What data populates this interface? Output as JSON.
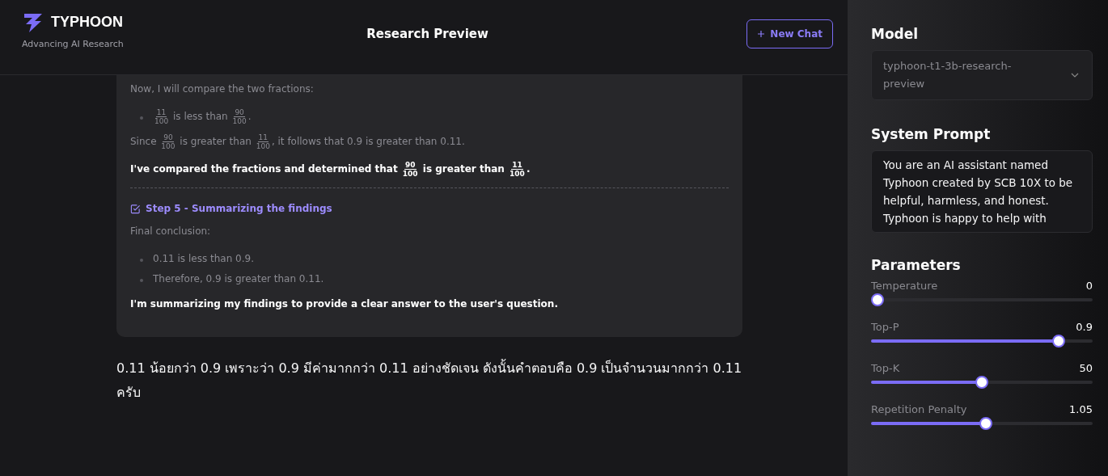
{
  "header": {
    "logo_title": "TYPHOON",
    "logo_subtitle": "Advancing AI Research",
    "title": "Research Preview",
    "new_chat_button": "New Chat"
  },
  "card": {
    "blocks": [
      {
        "kind": "paragraph",
        "strong": false,
        "segments": [
          {
            "kind": "text",
            "text": "Now, I will compare the two fractions:"
          }
        ]
      },
      {
        "kind": "bullets",
        "items": [
          [
            {
              "kind": "frac",
              "num": "11",
              "den": "100"
            },
            {
              "kind": "text",
              "text": " is less than "
            },
            {
              "kind": "frac",
              "num": "90",
              "den": "100"
            },
            {
              "kind": "text",
              "text": "."
            }
          ]
        ]
      },
      {
        "kind": "paragraph",
        "strong": false,
        "segments": [
          {
            "kind": "text",
            "text": "Since "
          },
          {
            "kind": "frac",
            "num": "90",
            "den": "100"
          },
          {
            "kind": "text",
            "text": " is greater than "
          },
          {
            "kind": "frac",
            "num": "11",
            "den": "100"
          },
          {
            "kind": "text",
            "text": ", it follows that 0.9 is greater than 0.11."
          }
        ]
      },
      {
        "kind": "paragraph",
        "strong": true,
        "segments": [
          {
            "kind": "text",
            "text": "I've compared the fractions and determined that "
          },
          {
            "kind": "frac",
            "num": "90",
            "den": "100"
          },
          {
            "kind": "text",
            "text": " is greater than "
          },
          {
            "kind": "frac",
            "num": "11",
            "den": "100"
          },
          {
            "kind": "text",
            "text": "."
          }
        ]
      },
      {
        "kind": "divider"
      },
      {
        "kind": "step",
        "label": "Step 5 - Summarizing the findings"
      },
      {
        "kind": "paragraph",
        "strong": false,
        "segments": [
          {
            "kind": "text",
            "text": "Final conclusion:"
          }
        ]
      },
      {
        "kind": "bullets",
        "items": [
          [
            {
              "kind": "text",
              "text": "0.11 is less than 0.9."
            }
          ],
          [
            {
              "kind": "text",
              "text": "Therefore, 0.9 is greater than 0.11."
            }
          ]
        ]
      },
      {
        "kind": "paragraph",
        "strong": true,
        "segments": [
          {
            "kind": "text",
            "text": "I'm summarizing my findings to provide a clear answer to the user's question."
          }
        ]
      }
    ]
  },
  "answer": "0.11 น้อยกว่า 0.9 เพราะว่า 0.9 มีค่ามากกว่า 0.11 อย่างชัดเจน ดังนั้นคำตอบคือ 0.9 เป็นจำนวนมากกว่า 0.11 ครับ",
  "sidebar": {
    "model": {
      "label": "Model",
      "value": "typhoon-t1-3b-research-preview"
    },
    "system_prompt": {
      "label": "System Prompt",
      "value": "You are an AI assistant named Typhoon created by SCB 10X to be helpful, harmless, and honest. Typhoon is happy to help with"
    },
    "parameters": {
      "label": "Parameters",
      "items": [
        {
          "label": "Temperature",
          "reading": "0",
          "level": 0
        },
        {
          "label": "Top-P",
          "reading": "0.9",
          "level": 0.87
        },
        {
          "label": "Top-K",
          "reading": "50",
          "level": 0.5
        },
        {
          "label": "Repetition Penalty",
          "reading": "1.05",
          "level": 0.52
        }
      ]
    }
  }
}
